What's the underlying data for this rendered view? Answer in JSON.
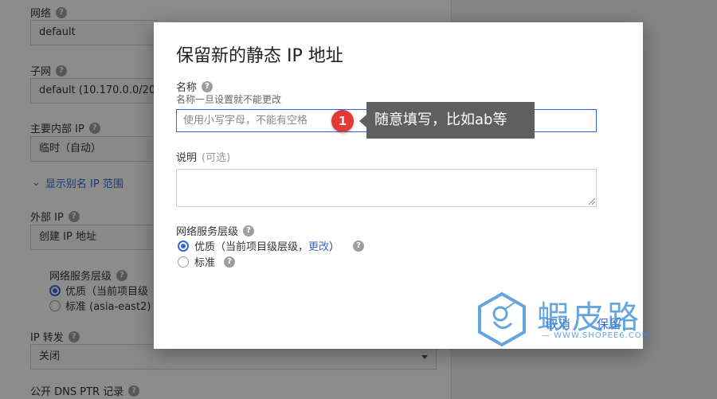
{
  "background_form": {
    "network": {
      "label": "网络",
      "value": "default"
    },
    "subnet": {
      "label": "子网",
      "value": "default (10.170.0.0/20)"
    },
    "internal_ip": {
      "label": "主要内部 IP",
      "value": "临时（自动）"
    },
    "alias_link": "显示别名 IP 范围",
    "external_ip": {
      "label": "外部 IP",
      "value": "创建 IP 地址"
    },
    "tier": {
      "label": "网络服务层级",
      "options": [
        "优质（当前项目级",
        "标准 (asia-east2)"
      ],
      "selected": 0
    },
    "ip_forwarding": {
      "label": "IP 转发",
      "value": "关闭"
    },
    "dns_ptr": {
      "label": "公开 DNS PTR 记录"
    }
  },
  "dialog": {
    "title": "保留新的静态 IP 地址",
    "name": {
      "label": "名称",
      "hint": "名称一旦设置就不能更改",
      "placeholder": "使用小写字母，不能有空格"
    },
    "description": {
      "label": "说明",
      "optional": "(可选)"
    },
    "tier": {
      "label": "网络服务层级",
      "premium": {
        "text": "优质（当前项目级层级，",
        "link": "更改",
        "suffix": "）"
      },
      "standard": "标准",
      "selected": "premium"
    },
    "cancel_label": "取消",
    "reserve_label": "保留"
  },
  "annotation": {
    "number": "1",
    "text": "随意填写，比如ab等",
    "color": "#e53935"
  },
  "watermark": {
    "name": "蝦皮路",
    "url": "— WWW.SHOPEE6.COM"
  },
  "colors": {
    "accent": "#3367d6",
    "badge": "#e53935",
    "tip_bg": "#5f5f5f"
  }
}
